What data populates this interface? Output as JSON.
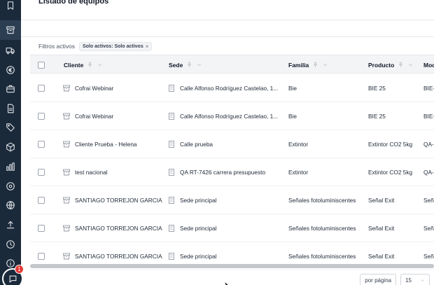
{
  "page": {
    "title": "Listado de equipos"
  },
  "sidebar": {
    "items": [
      {
        "icon": "bookmark-icon"
      },
      {
        "icon": "archive-box-icon",
        "active": true
      },
      {
        "icon": "truck-icon"
      },
      {
        "icon": "euro-icon"
      },
      {
        "icon": "briefcase-icon"
      },
      {
        "icon": "document-icon"
      },
      {
        "icon": "tag-icon"
      },
      {
        "icon": "cube-icon"
      },
      {
        "icon": "bar-chart-icon"
      },
      {
        "icon": "settings-icon"
      },
      {
        "icon": "globe-icon"
      },
      {
        "icon": "upload-icon"
      },
      {
        "icon": "clock-icon"
      },
      {
        "icon": "info-icon"
      }
    ],
    "chat_badge": "1"
  },
  "filters": {
    "label": "Filtros activos",
    "chips": [
      {
        "text": "Solo activos: Solo activos",
        "remove": "×"
      }
    ]
  },
  "table": {
    "columns": [
      "Cliente",
      "Sede",
      "Familia",
      "Producto",
      "Mod"
    ],
    "rows": [
      {
        "cliente": "Cofrai Webinar",
        "sede": "Calle Alfonso Rodríguez Castelao, 1...",
        "familia": "Bie",
        "producto": "BIE 25",
        "modelo": "BIE-"
      },
      {
        "cliente": "Cofrai Webinar",
        "sede": "Calle Alfonso Rodríguez Castelao, 1...",
        "familia": "Bie",
        "producto": "BIE 25",
        "modelo": "BIE-"
      },
      {
        "cliente": "Cliente Prueba - Helena",
        "sede": "Calle prueba",
        "familia": "Extintor",
        "producto": "Extintor CO2 5kg",
        "modelo": "QA-"
      },
      {
        "cliente": "test nacional",
        "sede": "QA RT-7426 carrera presupuesto",
        "familia": "Extintor",
        "producto": "Extintor CO2 5kg",
        "modelo": "QA-"
      },
      {
        "cliente": "SANTIAGO TORREJON GARCIA",
        "sede": "Sede principal",
        "familia": "Señales fotoluminiscentes",
        "producto": "Señal Exit",
        "modelo": "Señ"
      },
      {
        "cliente": "SANTIAGO TORREJON GARCIA",
        "sede": "Sede principal",
        "familia": "Señales fotoluminiscentes",
        "producto": "Señal Exit",
        "modelo": "Señ"
      },
      {
        "cliente": "SANTIAGO TORREJON GARCIA",
        "sede": "Sede principal",
        "familia": "Señales fotoluminiscentes",
        "producto": "Señal Exit",
        "modelo": "Señ"
      }
    ]
  },
  "pagination": {
    "per_page_label": "por página",
    "per_page_value": "15"
  }
}
